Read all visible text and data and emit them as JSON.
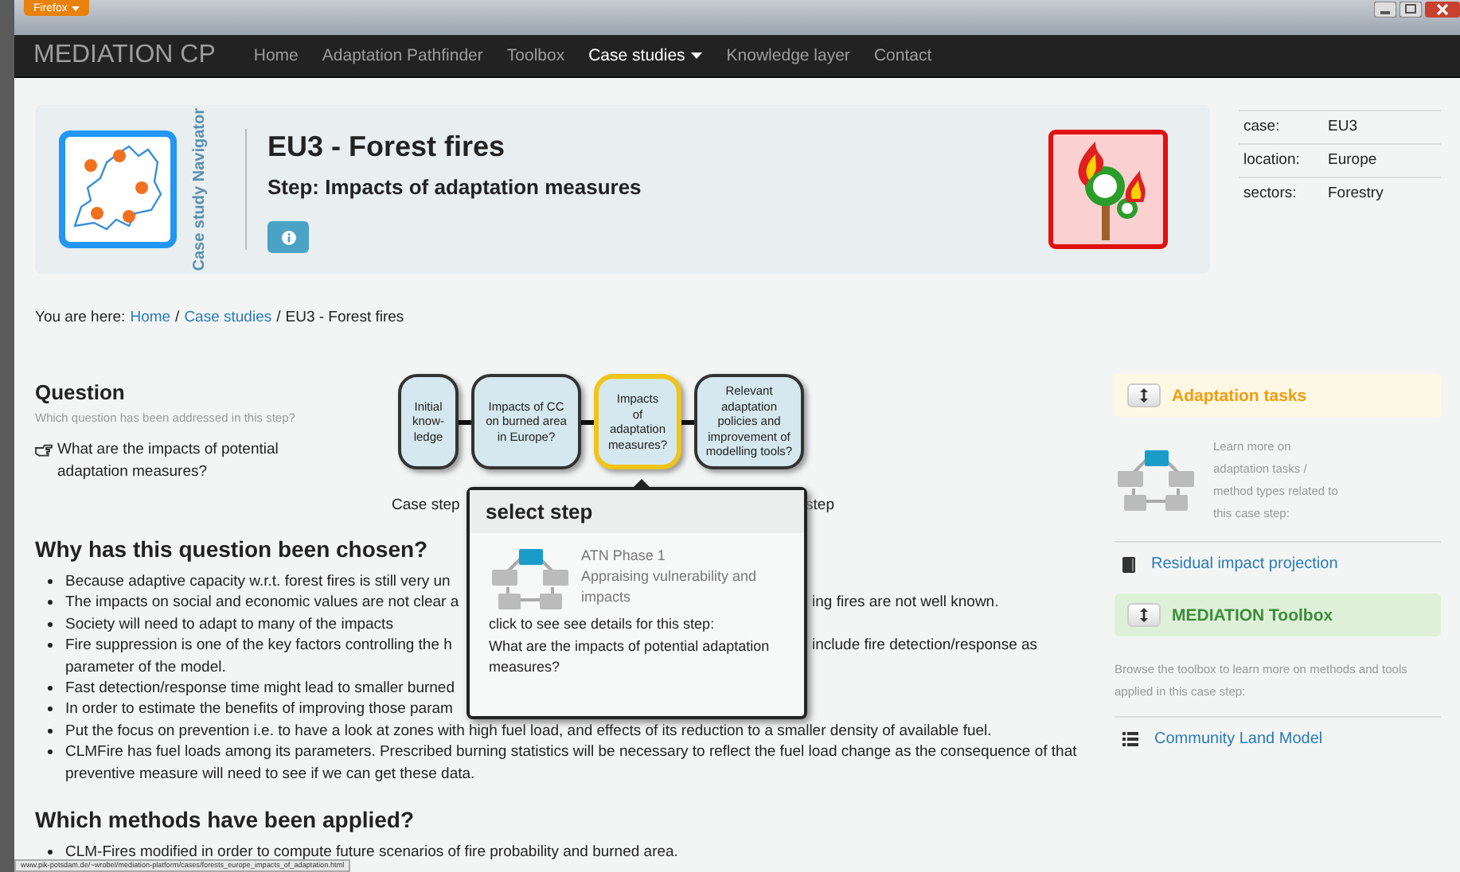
{
  "browser": {
    "menu_label": "Firefox",
    "status_url": "www.pik-potsdam.de/~wrobel/mediation-platform/cases/forests_europe_impacts_of_adaptation.html"
  },
  "navbar": {
    "brand": "MEDIATION CP",
    "items": [
      {
        "label": "Home",
        "selected": false,
        "dropdown": false
      },
      {
        "label": "Adaptation Pathfinder",
        "selected": false,
        "dropdown": false
      },
      {
        "label": "Toolbox",
        "selected": false,
        "dropdown": false
      },
      {
        "label": "Case studies",
        "selected": true,
        "dropdown": true
      },
      {
        "label": "Knowledge layer",
        "selected": false,
        "dropdown": false
      },
      {
        "label": "Contact",
        "selected": false,
        "dropdown": false
      }
    ]
  },
  "header": {
    "navigator_label": "Case study Navigator",
    "title": "EU3 - Forest fires",
    "step": "Step: Impacts of adaptation measures"
  },
  "case_info": [
    {
      "label": "case:",
      "value": "EU3"
    },
    {
      "label": "location:",
      "value": "Europe"
    },
    {
      "label": "sectors:",
      "value": "Forestry"
    }
  ],
  "breadcrumb": {
    "prefix": "You are here:",
    "links": [
      "Home",
      "Case studies"
    ],
    "separators": [
      "/",
      "/"
    ],
    "current": "EU3 - Forest fires"
  },
  "question": {
    "heading": "Question",
    "hint": "Which question has been addressed in this step?",
    "text": "What are the impacts of potential adaptation measures?"
  },
  "flow": {
    "nodes": [
      {
        "label": "Initial\nknow-\nledge",
        "selected": false
      },
      {
        "label": "Impacts of CC\non burned area\nin Europe?",
        "selected": false
      },
      {
        "label": "Impacts\nof\nadaptation\nmeasures?",
        "selected": true
      },
      {
        "label": "Relevant\nadaptation\npolicies and\nimprovement of\nmodelling tools?",
        "selected": false
      }
    ],
    "caption_left": "Case step",
    "caption_right": "step"
  },
  "popover": {
    "title": "select step",
    "phase": "ATN Phase 1",
    "phase_desc": "Appraising vulnerability and impacts",
    "click_text": "click to see see details for this step:",
    "question": "What are the impacts of potential adaptation measures?"
  },
  "why": {
    "heading": "Why has this question been chosen?",
    "items": [
      {
        "kind": "split",
        "left": "Because adaptive capacity w.r.t. forest fires is still very un"
      },
      {
        "kind": "split",
        "left": "The impacts on social and economic values are not clear a",
        "right": "ing fires are not well known."
      },
      {
        "kind": "full",
        "left": "Society will need to adapt to many of the impacts"
      },
      {
        "kind": "split",
        "left": "Fire suppression is one of the key factors controlling the h",
        "right": "include fire detection/response as",
        "continuation": "parameter of the model."
      },
      {
        "kind": "split",
        "left": "Fast detection/response time might lead to smaller burned"
      },
      {
        "kind": "split",
        "left": "In order to estimate the benefits of improving those param"
      },
      {
        "kind": "full",
        "left": "Put the focus on prevention i.e. to have a look at zones with high fuel load, and effects of its reduction to a smaller density of available fuel."
      },
      {
        "kind": "full",
        "left": "CLMFire has fuel loads among its parameters. Prescribed burning statistics will be necessary to reflect the fuel load change as the consequence of that preventive measure will need to see if we can get these data."
      }
    ]
  },
  "methods": {
    "heading": "Which methods have been applied?",
    "items": [
      "CLM-Fires modified in order to compute future scenarios of fire probability and burned area."
    ]
  },
  "sidebar": {
    "tasks": {
      "title": "Adaptation tasks",
      "text": "Learn more on adaptation tasks / method types related to this case step:",
      "link": "Residual impact projection"
    },
    "toolbox": {
      "title": "MEDIATION Toolbox",
      "text": "Browse the toolbox to learn more on methods and tools applied in this case step:",
      "link": "Community Land Model"
    }
  }
}
